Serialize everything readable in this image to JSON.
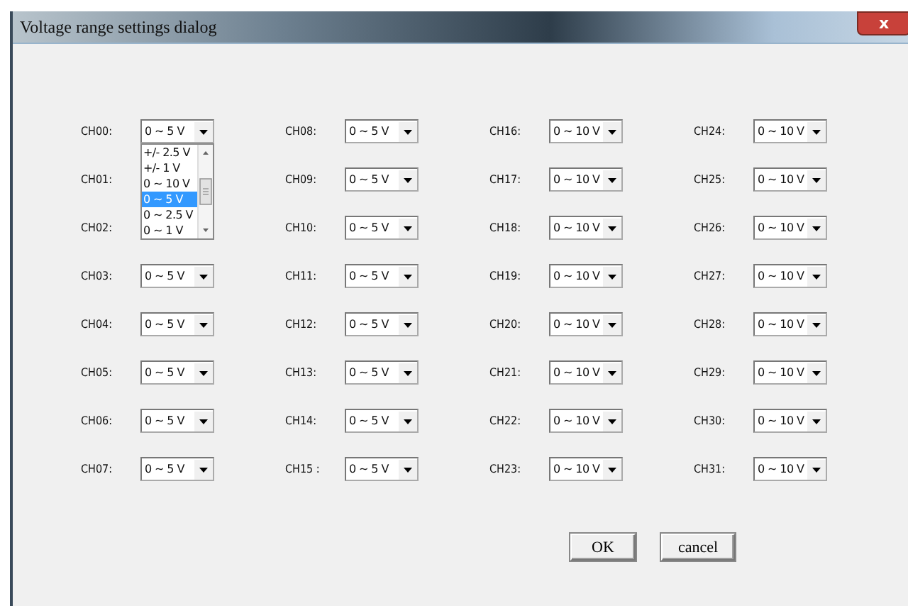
{
  "window": {
    "title": "Voltage range settings dialog",
    "close": "x"
  },
  "channels": [
    {
      "label": "CH00:",
      "value": "0 ~ 5 V"
    },
    {
      "label": "CH01:"
    },
    {
      "label": "CH02:"
    },
    {
      "label": "CH03:",
      "value": "0 ~ 5 V"
    },
    {
      "label": "CH04:",
      "value": "0 ~ 5 V"
    },
    {
      "label": "CH05:",
      "value": "0 ~ 5 V"
    },
    {
      "label": "CH06:",
      "value": "0 ~ 5 V"
    },
    {
      "label": "CH07:",
      "value": "0 ~ 5 V"
    },
    {
      "label": "CH08:",
      "value": "0 ~ 5 V"
    },
    {
      "label": "CH09:",
      "value": "0 ~ 5 V"
    },
    {
      "label": "CH10:",
      "value": "0 ~ 5 V"
    },
    {
      "label": "CH11:",
      "value": "0 ~ 5 V"
    },
    {
      "label": "CH12:",
      "value": "0 ~ 5 V"
    },
    {
      "label": "CH13:",
      "value": "0 ~ 5 V"
    },
    {
      "label": "CH14:",
      "value": "0 ~ 5 V"
    },
    {
      "label": "CH15 :",
      "value": "0 ~ 5 V"
    },
    {
      "label": "CH16:",
      "value": "0 ~ 10 V"
    },
    {
      "label": "CH17:",
      "value": "0 ~ 10 V"
    },
    {
      "label": "CH18:",
      "value": "0 ~ 10 V"
    },
    {
      "label": "CH19:",
      "value": "0 ~ 10 V"
    },
    {
      "label": "CH20:",
      "value": "0 ~ 10 V"
    },
    {
      "label": "CH21:",
      "value": "0 ~ 10 V"
    },
    {
      "label": "CH22:",
      "value": "0 ~ 10 V"
    },
    {
      "label": "CH23:",
      "value": "0 ~ 10 V"
    },
    {
      "label": "CH24:",
      "value": "0 ~ 10 V"
    },
    {
      "label": "CH25:",
      "value": "0 ~ 10 V"
    },
    {
      "label": "CH26:",
      "value": "0 ~ 10 V"
    },
    {
      "label": "CH27:",
      "value": "0 ~ 10 V"
    },
    {
      "label": "CH28:",
      "value": "0 ~ 10 V"
    },
    {
      "label": "CH29:",
      "value": "0 ~ 10 V"
    },
    {
      "label": "CH30:",
      "value": "0 ~ 10 V"
    },
    {
      "label": "CH31:",
      "value": "0 ~ 10 V"
    }
  ],
  "dropdown": {
    "options": [
      {
        "label": "+/- 2.5 V",
        "selected": false
      },
      {
        "label": "+/- 1 V",
        "selected": false
      },
      {
        "label": "0 ~ 10 V",
        "selected": false
      },
      {
        "label": "0 ~ 5 V",
        "selected": true
      },
      {
        "label": "0 ~ 2.5 V",
        "selected": false
      },
      {
        "label": "0 ~ 1 V",
        "selected": false
      }
    ]
  },
  "buttons": [
    "OK",
    "cancel"
  ]
}
